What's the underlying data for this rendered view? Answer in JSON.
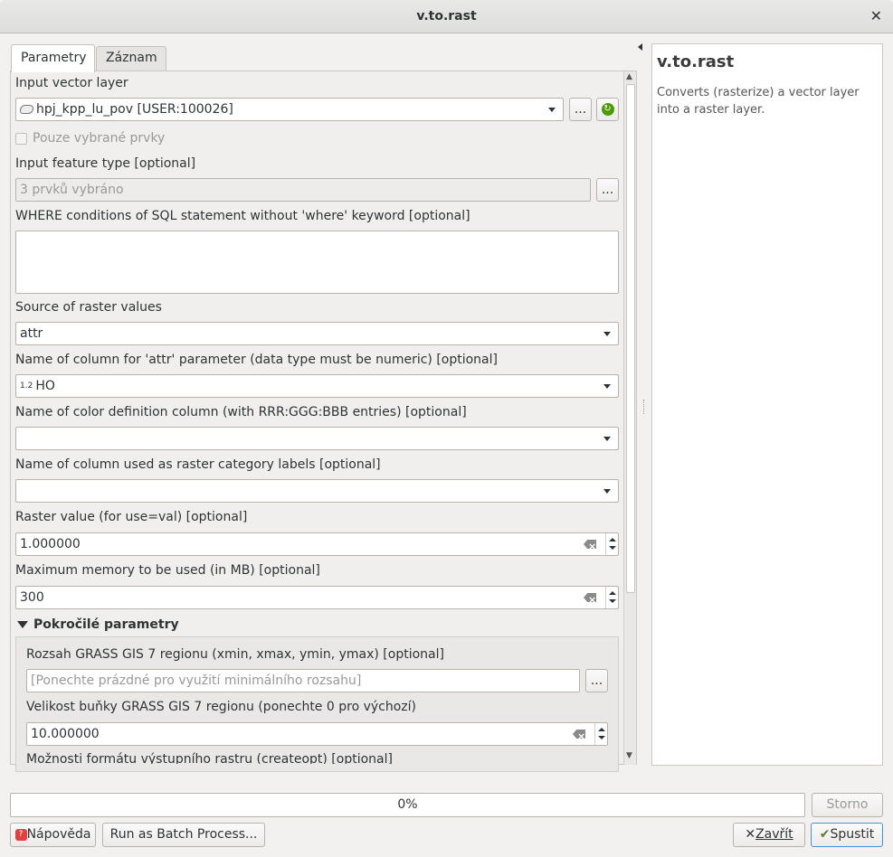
{
  "window": {
    "title": "v.to.rast"
  },
  "tabs": [
    {
      "label": "Parametry"
    },
    {
      "label": "Záznam"
    }
  ],
  "params": {
    "input_vector_label": "Input vector layer",
    "input_vector_value": "hpj_kpp_lu_pov [USER:100026]",
    "selected_only_label": "Pouze vybrané prvky",
    "feature_type_label": "Input feature type [optional]",
    "feature_type_value": "3 prvků vybráno",
    "where_label": "WHERE conditions of SQL statement without 'where' keyword [optional]",
    "where_value": "",
    "source_label": "Source of raster values",
    "source_value": "attr",
    "attr_col_label": "Name of column for 'attr' parameter (data type must be numeric) [optional]",
    "attr_col_type": "1.2",
    "attr_col_value": "HO",
    "color_col_label": "Name of color definition column (with RRR:GGG:BBB entries) [optional]",
    "label_col_label": "Name of column used as raster category labels [optional]",
    "raster_value_label": "Raster value (for use=val) [optional]",
    "raster_value": "1.000000",
    "memory_label": "Maximum memory to be used (in MB) [optional]",
    "memory_value": "300",
    "ellipsis": "...",
    "advanced": {
      "header": "Pokročilé parametry",
      "region_label": "Rozsah GRASS GIS 7 regionu (xmin, xmax, ymin, ymax) [optional]",
      "region_placeholder": "[Ponechte prázdné pro využití minimálního rozsahu]",
      "cell_label": "Velikost buňky GRASS GIS 7 regionu (ponechte 0 pro výchozí)",
      "cell_value": "10.000000",
      "createopt_label": "Možnosti formátu výstupního rastru (createopt) [optional]"
    }
  },
  "help": {
    "title": "v.to.rast",
    "description": "Converts (rasterize) a vector layer into a raster layer."
  },
  "progress": {
    "text": "0%",
    "percent": 0
  },
  "buttons": {
    "cancel": "Storno",
    "help": "Nápověda",
    "batch": "Run as Batch Process...",
    "close": "Zavřít",
    "run": "Spustit"
  }
}
